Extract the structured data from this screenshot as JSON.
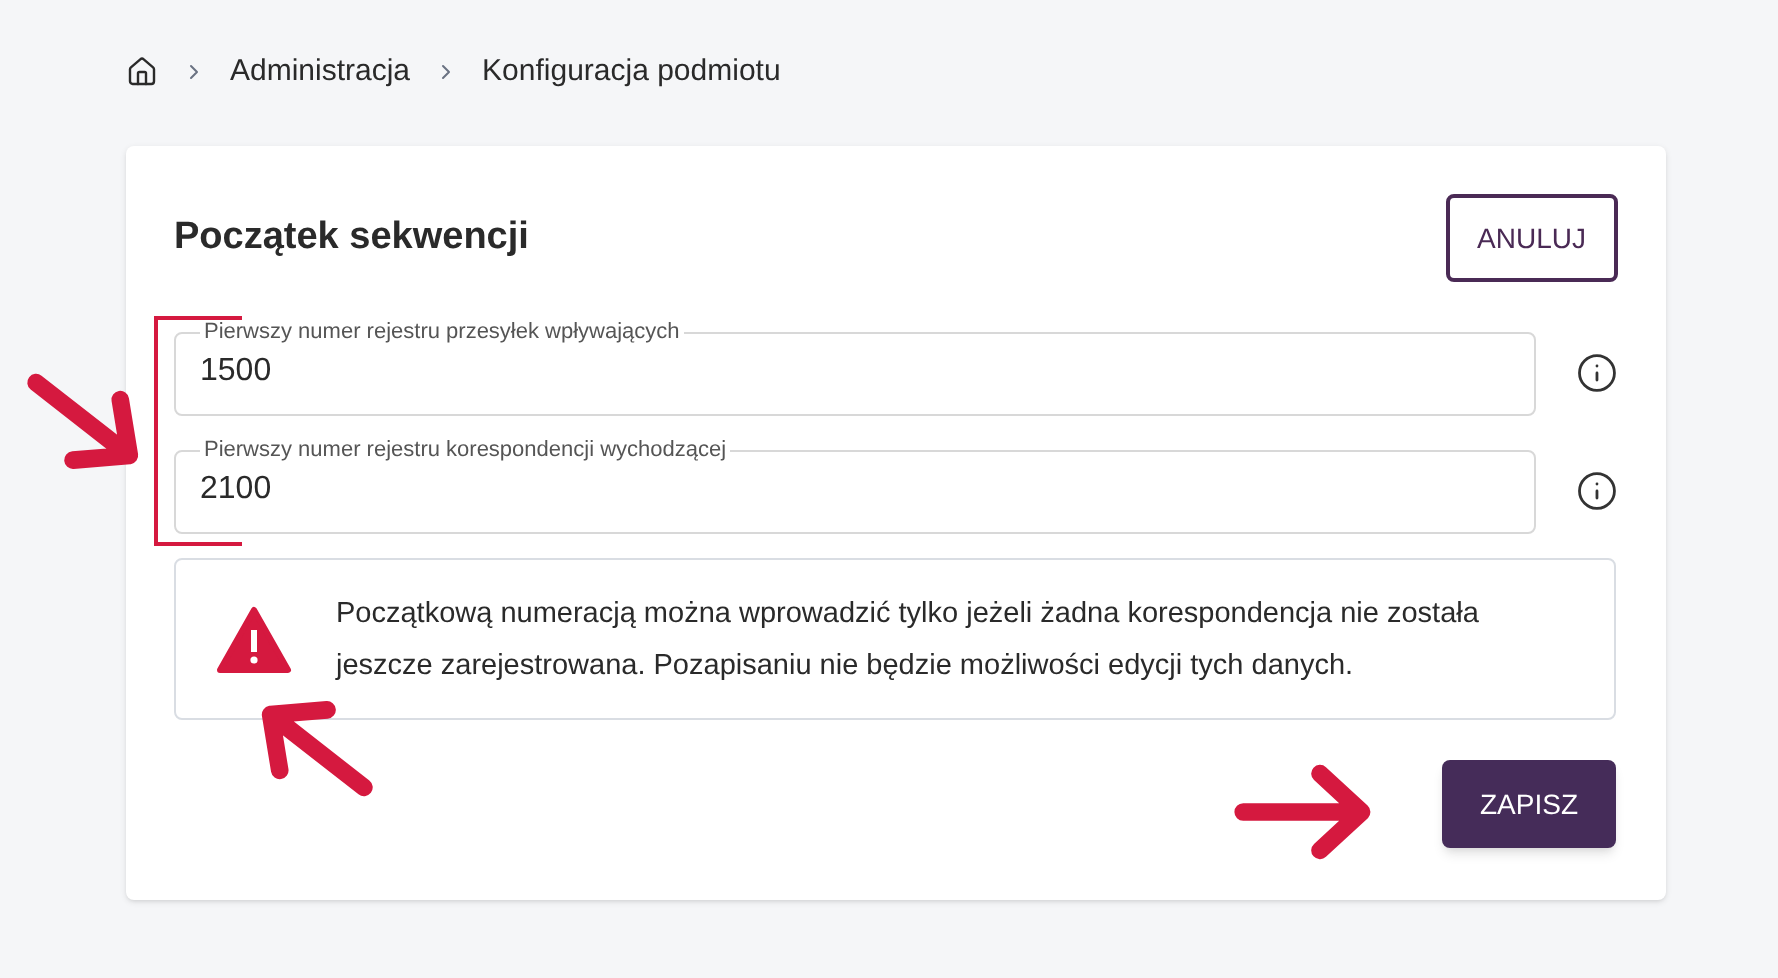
{
  "breadcrumb": [
    {
      "label": "Administracja"
    },
    {
      "label": "Konfiguracja podmiotu"
    }
  ],
  "card": {
    "title": "Początek sekwencji",
    "cancel_button": "ANULUJ",
    "fields": [
      {
        "label": "Pierwszy numer rejestru przesyłek wpływających",
        "value": "1500"
      },
      {
        "label": "Pierwszy numer rejestru korespondencji wychodzącej",
        "value": "2100"
      }
    ],
    "alert": {
      "text": "Początkową numeracją można wprowadzić tylko jeżeli żadna korespondencja nie została jeszcze zarejestrowana. Pozapisaniu nie będzie możliwości edycji tych danych."
    },
    "save_button": "ZAPISZ"
  }
}
